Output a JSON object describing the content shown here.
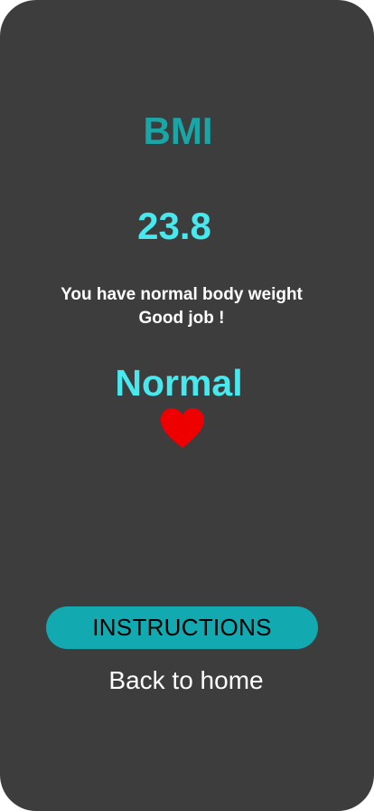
{
  "result": {
    "title": "BMI",
    "bmi_value": "23.8",
    "message_line1": "You have normal body weight",
    "message_line2": "Good job !",
    "category": "Normal",
    "status_icon": "heart-icon"
  },
  "actions": {
    "instructions_label": "INSTRUCTIONS",
    "back_label": "Back to home"
  },
  "colors": {
    "background": "#3d3d3d",
    "title": "#1aa6a6",
    "accent": "#47e8ee",
    "button": "#12a9b0",
    "heart": "#ee0000",
    "text": "#ffffff"
  }
}
